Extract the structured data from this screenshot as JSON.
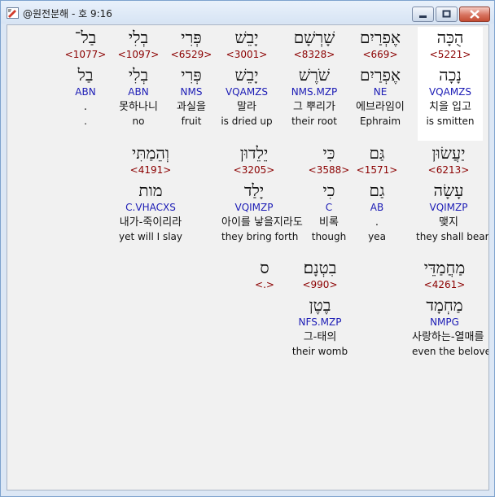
{
  "window": {
    "title": "@원전분해 - 호 9:16"
  },
  "rows": [
    [
      {
        "heb": "הֻכָּה",
        "strong": "<5221>",
        "lemma": "נָכָה",
        "code": "VQAMZS",
        "kor": "치을 입고",
        "eng": "is smitten",
        "selected": true
      },
      {
        "heb": "אֶפְרַיִם",
        "strong": "<669>",
        "lemma": "אֶפְרַיִם",
        "code": "NE",
        "kor": "에브라임이",
        "eng": "Ephraim"
      },
      {
        "heb": "שָׁרְשָׁם",
        "strong": "<8328>",
        "lemma": "שֹׁרֶשׁ",
        "code": "NMS.MZP",
        "kor": "그 뿌리가",
        "eng": "their root"
      },
      {
        "heb": "יָבֵשׁ",
        "strong": "<3001>",
        "lemma": "יָבֵשׁ",
        "code": "VQAMZS",
        "kor": "말라",
        "eng": "is dried up"
      },
      {
        "heb": "פְּרִי",
        "strong": "<6529>",
        "lemma": "פְּרִי",
        "code": "NMS",
        "kor": "과실을",
        "eng": "fruit"
      },
      {
        "heb": "בְלִי",
        "strong": "<1097>",
        "lemma": "בְלִי",
        "code": "ABN",
        "kor": "못하나니",
        "eng": "no"
      },
      {
        "heb": "בַל־",
        "strong": "<1077>",
        "lemma": "בַל",
        "code": "ABN",
        "kor": ".",
        "eng": "."
      }
    ],
    [
      {
        "heb": "יַעֲשׂוּן",
        "strong": "<6213>",
        "lemma": "עָשָׂה",
        "code": "VQIMZP",
        "kor": "맺지",
        "eng": "they shall bear"
      },
      {
        "heb": "גַּם",
        "strong": "<1571>",
        "lemma": "גַם",
        "code": "AB",
        "kor": ".",
        "eng": "yea"
      },
      {
        "heb": "כִּי",
        "strong": "<3588>",
        "lemma": "כִי",
        "code": "C",
        "kor": "비록",
        "eng": "though"
      },
      {
        "heb": "יֵלֵדוּן",
        "strong": "<3205>",
        "lemma": "יָלַד",
        "code": "VQIMZP",
        "kor": "아이를 낳을지라도",
        "eng": "they bring forth"
      },
      {
        "heb": "וְהֵמַתִּי",
        "strong": "<4191>",
        "lemma": "מות",
        "code": "C.VHACXS",
        "kor": "내가-죽이리라",
        "eng": "yet will I slay"
      }
    ],
    [
      {
        "heb": "מַחֲמַדֵּי",
        "strong": "<4261>",
        "lemma": "מַחְמָד",
        "code": "NMPG",
        "kor": "사랑하는-열매를",
        "eng": "even the beloved fruit of"
      },
      {
        "heb": "בִטְנָם׃",
        "strong": "<990>",
        "lemma": "בֶטֶן",
        "code": "NFS.MZP",
        "kor": "그-태의",
        "eng": "their womb"
      },
      {
        "heb": "ס",
        "strong": "<.>",
        "lemma": "",
        "code": "",
        "kor": "",
        "eng": ""
      }
    ]
  ]
}
